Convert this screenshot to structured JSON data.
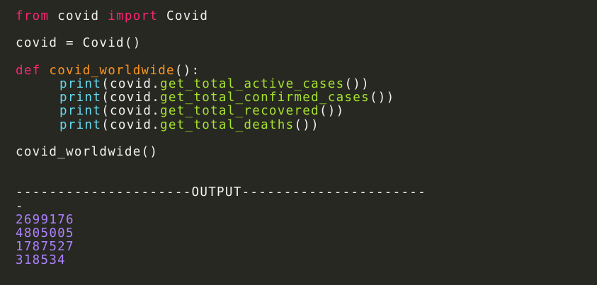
{
  "code": {
    "line1": {
      "kw_from": "from",
      "module": " covid ",
      "kw_import": "import",
      "cls": " Covid"
    },
    "line2": {
      "text": "covid = Covid()"
    },
    "line3": {
      "kw_def": "def",
      "space": " ",
      "func_name": "covid_worldwide",
      "tail": "():"
    },
    "prints": [
      {
        "builtin": "print",
        "open": "(covid.",
        "method": "get_total_active_cases",
        "close": "())"
      },
      {
        "builtin": "print",
        "open": "(covid.",
        "method": "get_total_confirmed_cases",
        "close": "())"
      },
      {
        "builtin": "print",
        "open": "(covid.",
        "method": "get_total_recovered",
        "close": "())"
      },
      {
        "builtin": "print",
        "open": "(covid.",
        "method": "get_total_deaths",
        "close": "())"
      }
    ],
    "call": "covid_worldwide()"
  },
  "output": {
    "separator": "---------------------OUTPUT----------------------",
    "separator_wrap": "-",
    "values": [
      "2699176",
      "4805005",
      "1787527",
      "318534"
    ]
  },
  "colors": {
    "background": "#272822",
    "keyword": "#f92672",
    "function_name": "#fd971f",
    "builtin": "#66d9ef",
    "method": "#a6e22e",
    "text": "#f2f2f2",
    "output_number": "#ae81ff"
  }
}
